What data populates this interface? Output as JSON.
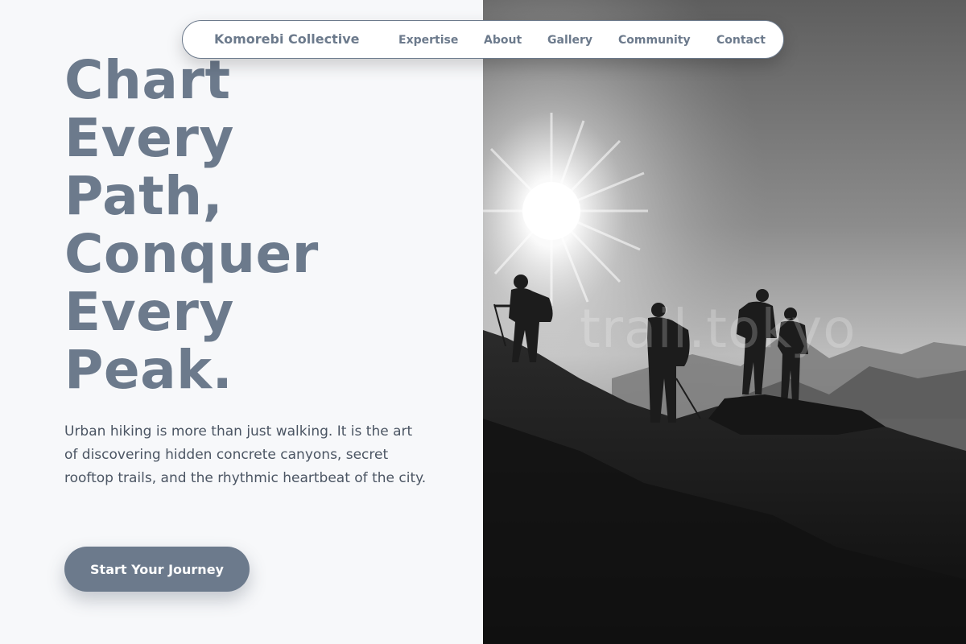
{
  "nav": {
    "brand": "Komorebi Collective",
    "links": [
      "Expertise",
      "About",
      "Gallery",
      "Community",
      "Contact"
    ]
  },
  "hero": {
    "headline_lines": [
      "Chart",
      "Every",
      "Path,",
      "Conquer",
      "Every",
      "Peak."
    ],
    "intro": "Urban hiking is more than just walking. It is the art of discovering hidden concrete canyons, secret rooftop trails, and the rhythmic heartbeat of the city.",
    "cta_label": "Start Your Journey"
  },
  "image": {
    "watermark": "trail.tokyo",
    "alt": "Silhouetted hikers on a mountain ridge at sunrise"
  },
  "colors": {
    "accent": "#6c7a8c",
    "background": "#f7f8fa",
    "body_text": "#4b5563"
  }
}
